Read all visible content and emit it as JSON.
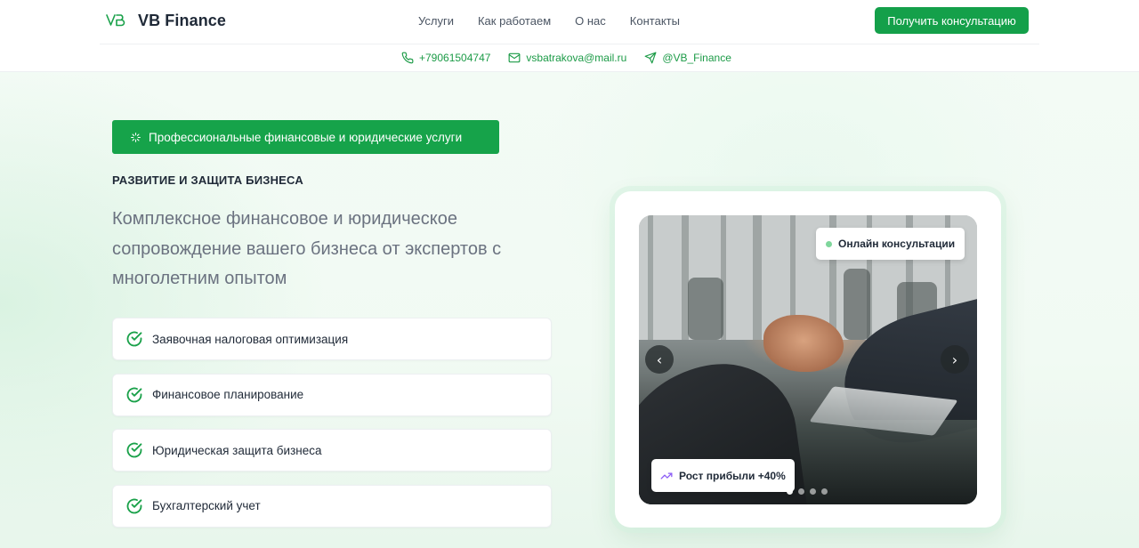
{
  "header": {
    "brand_mark": "VB",
    "brand_name": "VB Finance",
    "nav": [
      {
        "label": "Услуги"
      },
      {
        "label": "Как работаем"
      },
      {
        "label": "О нас"
      },
      {
        "label": "Контакты"
      }
    ],
    "cta_label": "Получить консультацию"
  },
  "contacts": {
    "phone": "+79061504747",
    "email": "vsbatrakova@mail.ru",
    "telegram": "@VB_Finance"
  },
  "hero": {
    "pill_label": "Профессиональные финансовые и юридические услуги",
    "eyebrow": "РАЗВИТИЕ И ЗАЩИТА БИЗНЕСА",
    "lead": "Комплексное финансовое и юридическое сопровождение вашего бизнеса от экспертов с многолетним опытом",
    "features": [
      {
        "label": "Заявочная налоговая оптимизация"
      },
      {
        "label": "Финансовое планирование"
      },
      {
        "label": "Юридическая защита бизнеса"
      },
      {
        "label": "Бухгалтерский учет"
      }
    ]
  },
  "carousel": {
    "online_badge": "Онлайн консультации",
    "growth_badge": "Рост прибыли +40%",
    "prev_symbol": "‹",
    "next_symbol": "›",
    "slide_count": 4,
    "active_slide": 1
  },
  "colors": {
    "accent": "#16a34a",
    "text": "#1f2937",
    "muted": "#6b7280",
    "growth_icon": "#8b5cf6"
  }
}
